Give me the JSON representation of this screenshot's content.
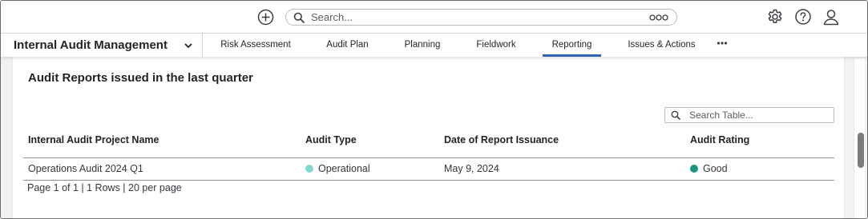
{
  "topbar": {
    "search_placeholder": "Search...",
    "icons": [
      "add-icon",
      "search-icon",
      "search-options-icon",
      "settings-icon",
      "help-icon",
      "user-icon"
    ]
  },
  "navbar": {
    "app_name": "Internal Audit Management",
    "tabs": [
      {
        "label": "Risk Assessment"
      },
      {
        "label": "Audit Plan"
      },
      {
        "label": "Planning"
      },
      {
        "label": "Fieldwork"
      },
      {
        "label": "Reporting",
        "active": true
      },
      {
        "label": "Issues & Actions"
      }
    ],
    "more_label": "•••"
  },
  "report": {
    "title": "Audit Reports issued in the last quarter",
    "table_search_placeholder": "Search Table...",
    "columns": [
      "Internal Audit Project Name",
      "Audit Type",
      "Date of Report Issuance",
      "Audit Rating"
    ],
    "rows": [
      {
        "project_name": "Operations Audit 2024 Q1",
        "audit_type": "Operational",
        "audit_type_color": "#7fd8d0",
        "date": "May 9, 2024",
        "rating": "Good",
        "rating_color": "#1a9480"
      }
    ],
    "pagination": "Page 1 of 1 | 1 Rows | 20 per page"
  },
  "colors": {
    "accent": "#2d67b4",
    "operational_dot": "#7fd8d0",
    "good_dot": "#1a9480"
  }
}
